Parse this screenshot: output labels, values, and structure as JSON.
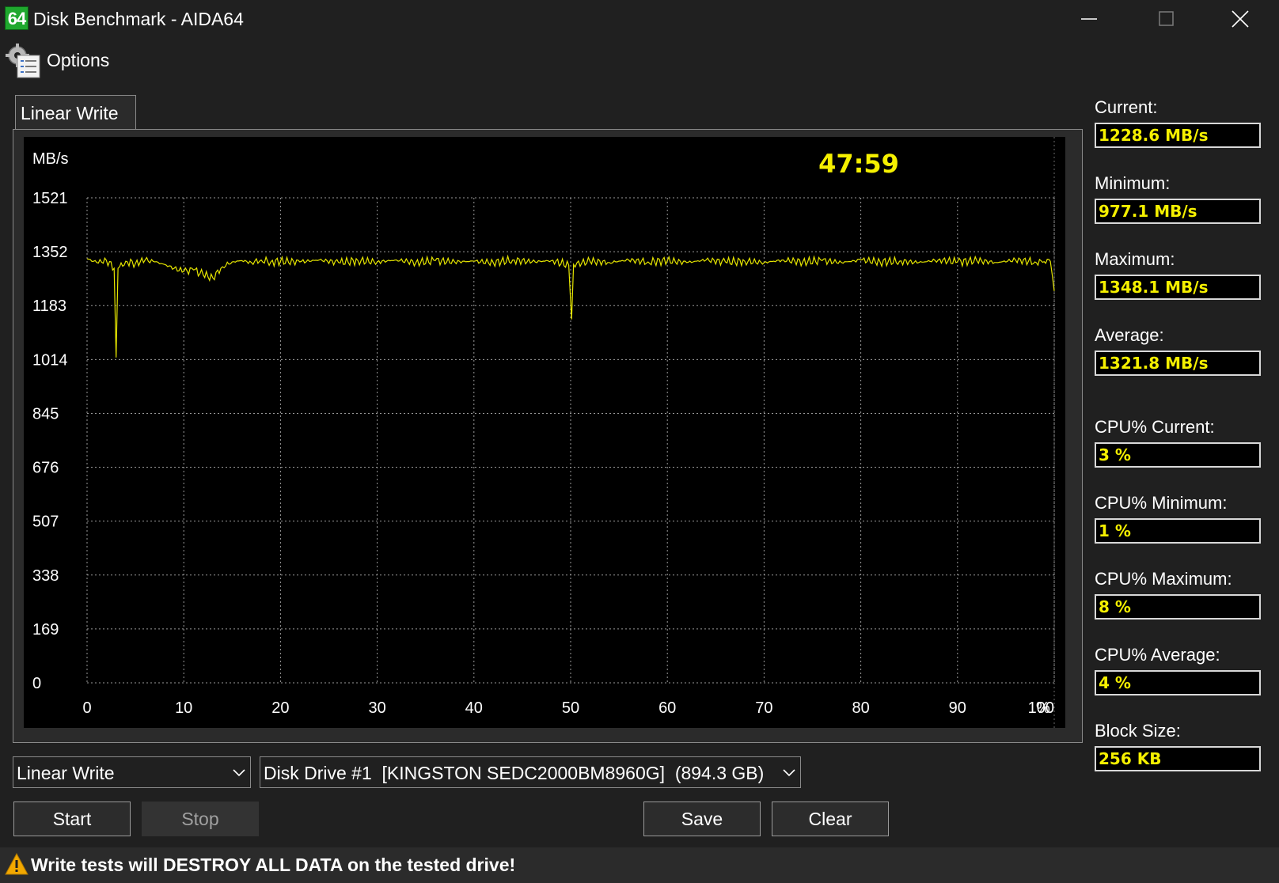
{
  "window": {
    "app_icon_text": "64",
    "title": "Disk Benchmark - AIDA64",
    "controls": [
      "minimize",
      "maximize",
      "close"
    ]
  },
  "menu": {
    "options_label": "Options",
    "options_icon": "options-gear-list-icon"
  },
  "tab": {
    "label": "Linear Write"
  },
  "chart": {
    "timer": "47:59",
    "y_unit": "MB/s",
    "x_unit": "%"
  },
  "chart_data": {
    "type": "line",
    "title": "",
    "xlabel": "%",
    "ylabel": "MB/s",
    "xlim": [
      0,
      100
    ],
    "ylim": [
      0,
      1521
    ],
    "y_ticks": [
      0,
      169,
      338,
      507,
      676,
      845,
      1014,
      1183,
      1352,
      1521
    ],
    "x_ticks": [
      0,
      10,
      20,
      30,
      40,
      50,
      60,
      70,
      80,
      90,
      100
    ],
    "grid": true,
    "line_color": "#e6e600",
    "series": [
      {
        "values": [
          [
            0,
            1330
          ],
          [
            1,
            1318
          ],
          [
            2,
            1325
          ],
          [
            2.8,
            1300
          ],
          [
            3.0,
            1020
          ],
          [
            3.2,
            1300
          ],
          [
            4,
            1322
          ],
          [
            5,
            1315
          ],
          [
            6,
            1326
          ],
          [
            7,
            1320
          ],
          [
            8,
            1312
          ],
          [
            9,
            1300
          ],
          [
            10,
            1290
          ],
          [
            11,
            1295
          ],
          [
            12,
            1280
          ],
          [
            13,
            1270
          ],
          [
            14,
            1305
          ],
          [
            15,
            1320
          ],
          [
            16,
            1324
          ],
          [
            17,
            1318
          ],
          [
            18,
            1326
          ],
          [
            19,
            1320
          ],
          [
            20,
            1322
          ],
          [
            22,
            1320
          ],
          [
            24,
            1326
          ],
          [
            26,
            1318
          ],
          [
            28,
            1324
          ],
          [
            30,
            1320
          ],
          [
            32,
            1326
          ],
          [
            34,
            1318
          ],
          [
            36,
            1324
          ],
          [
            38,
            1320
          ],
          [
            40,
            1322
          ],
          [
            42,
            1318
          ],
          [
            44,
            1326
          ],
          [
            46,
            1320
          ],
          [
            48,
            1324
          ],
          [
            49.8,
            1310
          ],
          [
            50.1,
            1140
          ],
          [
            50.3,
            1312
          ],
          [
            52,
            1322
          ],
          [
            54,
            1318
          ],
          [
            56,
            1326
          ],
          [
            58,
            1320
          ],
          [
            60,
            1324
          ],
          [
            62,
            1318
          ],
          [
            64,
            1326
          ],
          [
            66,
            1320
          ],
          [
            68,
            1322
          ],
          [
            70,
            1318
          ],
          [
            72,
            1326
          ],
          [
            74,
            1320
          ],
          [
            76,
            1324
          ],
          [
            78,
            1318
          ],
          [
            80,
            1326
          ],
          [
            82,
            1320
          ],
          [
            84,
            1322
          ],
          [
            86,
            1318
          ],
          [
            88,
            1326
          ],
          [
            90,
            1320
          ],
          [
            92,
            1324
          ],
          [
            94,
            1318
          ],
          [
            96,
            1326
          ],
          [
            98,
            1320
          ],
          [
            99.6,
            1322
          ],
          [
            100,
            1228.6
          ]
        ]
      }
    ]
  },
  "stats": [
    {
      "label": "Current:",
      "value": "1228.6 MB/s"
    },
    {
      "label": "Minimum:",
      "value": "977.1 MB/s"
    },
    {
      "label": "Maximum:",
      "value": "1348.1 MB/s"
    },
    {
      "label": "Average:",
      "value": "1321.8 MB/s"
    },
    {
      "label": "CPU% Current:",
      "value": "3 %"
    },
    {
      "label": "CPU% Minimum:",
      "value": "1 %"
    },
    {
      "label": "CPU% Maximum:",
      "value": "8 %"
    },
    {
      "label": "CPU% Average:",
      "value": "4 %"
    },
    {
      "label": "Block Size:",
      "value": "256 KB"
    }
  ],
  "controls": {
    "test_select": "Linear Write",
    "drive_select": "Disk Drive #1  [KINGSTON SEDC2000BM8960G]  (894.3 GB)",
    "start_label": "Start",
    "stop_label": "Stop",
    "save_label": "Save",
    "clear_label": "Clear"
  },
  "warning": {
    "icon": "warning-icon",
    "text": "Write tests will DESTROY ALL DATA on the tested drive!"
  },
  "colors": {
    "background": "#202020",
    "chart_bg": "#000000",
    "grid": "#9a9a9a",
    "line": "#e6e600",
    "value_text": "#f5f000",
    "timer": "#f5f000"
  }
}
